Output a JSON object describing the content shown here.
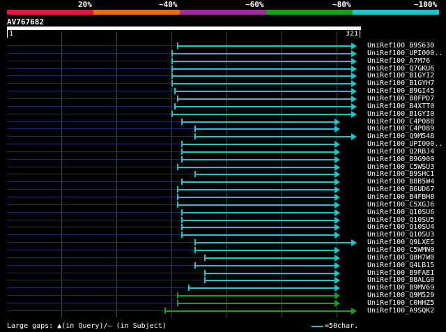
{
  "header": {
    "percent_labels": [
      "20%",
      "~40%",
      "~60%",
      "~80%",
      "~100%"
    ],
    "band_colors": [
      "#e8143c",
      "#e87010",
      "#a02ca0",
      "#18a018",
      "#18c8d0"
    ]
  },
  "query": {
    "name": "AV767682",
    "length_start": "1",
    "length_end": "321"
  },
  "hits": [
    {
      "label": "UniRef100_B9S630",
      "color": "#18c8d0"
    },
    {
      "label": "UniRef100_UPI000..",
      "color": "#18c8d0"
    },
    {
      "label": "UniRef100_A7M76",
      "color": "#18c8d0"
    },
    {
      "label": "UniRef100_Q7GKU6",
      "color": "#18c8d0"
    },
    {
      "label": "UniRef100_B1GYI2",
      "color": "#18c8d0"
    },
    {
      "label": "UniRef100_B1GYH7",
      "color": "#18c8d0"
    },
    {
      "label": "UniRef100_B9GI45",
      "color": "#18c8d0"
    },
    {
      "label": "UniRef100_B0FPD7",
      "color": "#18c8d0"
    },
    {
      "label": "UniRef100_B4XTT0",
      "color": "#18c8d0"
    },
    {
      "label": "UniRef100_B1GYI0",
      "color": "#18c8d0"
    },
    {
      "label": "UniRef100_C4P088",
      "color": "#18c8d0"
    },
    {
      "label": "UniRef100_C4P089",
      "color": "#18c8d0"
    },
    {
      "label": "UniRef100_Q9M548",
      "color": "#18c8d0"
    },
    {
      "label": "UniRef100_UPI000..",
      "color": "#18c8d0"
    },
    {
      "label": "UniRef100_Q2RBJ4",
      "color": "#18c8d0"
    },
    {
      "label": "UniRef100_B9G900",
      "color": "#18c8d0"
    },
    {
      "label": "UniRef100_C5WSU3",
      "color": "#18c8d0"
    },
    {
      "label": "UniRef100_B9SHC1",
      "color": "#18c8d0"
    },
    {
      "label": "UniRef100_B8B5W4",
      "color": "#18c8d0"
    },
    {
      "label": "UniRef100_B6UD67",
      "color": "#18c8d0"
    },
    {
      "label": "UniRef100_B4FBH8",
      "color": "#18c8d0"
    },
    {
      "label": "UniRef100_C5XGJ6",
      "color": "#18c8d0"
    },
    {
      "label": "UniRef100_Q10SU6",
      "color": "#18c8d0"
    },
    {
      "label": "UniRef100_Q10SU5",
      "color": "#18c8d0"
    },
    {
      "label": "UniRef100_Q10SU4",
      "color": "#18c8d0"
    },
    {
      "label": "UniRef100_Q10SU3",
      "color": "#18c8d0"
    },
    {
      "label": "UniRef100_Q9LXE5",
      "color": "#18c8d0"
    },
    {
      "label": "UniRef100_C5WMN0",
      "color": "#18c8d0"
    },
    {
      "label": "UniRef100_Q8H7W0",
      "color": "#18c8d0"
    },
    {
      "label": "UniRef100_Q4LB15",
      "color": "#18c8d0"
    },
    {
      "label": "UniRef100_B9FAE1",
      "color": "#18c8d0"
    },
    {
      "label": "UniRef100_B8ALG0",
      "color": "#18c8d0"
    },
    {
      "label": "UniRef100_B9MV69",
      "color": "#18c8d0"
    },
    {
      "label": "UniRef100_Q9M529",
      "color": "#18a018"
    },
    {
      "label": "UniRef100_C0HHZ5",
      "color": "#18a018"
    },
    {
      "label": "UniRef100_A9SQK2",
      "color": "#18a018"
    }
  ],
  "footer": {
    "gaps_text": "Large gaps: ▲(in Query)/– (in Subject)",
    "scale_text": "=50char.",
    "scale_color": "#18c8d0"
  }
}
